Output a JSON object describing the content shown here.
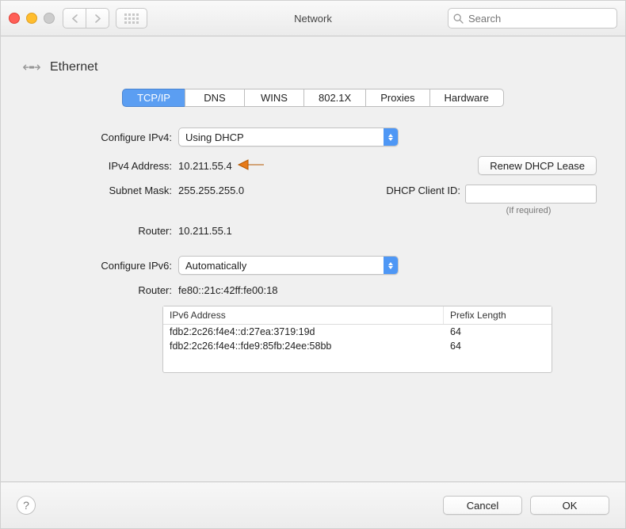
{
  "window": {
    "title": "Network"
  },
  "toolbar": {
    "search_placeholder": "Search"
  },
  "page": {
    "title": "Ethernet"
  },
  "tabs": [
    "TCP/IP",
    "DNS",
    "WINS",
    "802.1X",
    "Proxies",
    "Hardware"
  ],
  "ipv4": {
    "configure_label": "Configure IPv4:",
    "configure_value": "Using DHCP",
    "address_label": "IPv4 Address:",
    "address_value": "10.211.55.4",
    "subnet_label": "Subnet Mask:",
    "subnet_value": "255.255.255.0",
    "router_label": "Router:",
    "router_value": "10.211.55.1",
    "renew_button": "Renew DHCP Lease",
    "dhcp_client_label": "DHCP Client ID:",
    "dhcp_client_value": "",
    "dhcp_client_note": "(If required)"
  },
  "ipv6": {
    "configure_label": "Configure IPv6:",
    "configure_value": "Automatically",
    "router_label": "Router:",
    "router_value": "fe80::21c:42ff:fe00:18",
    "table": {
      "cols": [
        "IPv6 Address",
        "Prefix Length"
      ],
      "rows": [
        {
          "addr": "fdb2:2c26:f4e4::d:27ea:3719:19d",
          "prefix": "64"
        },
        {
          "addr": "fdb2:2c26:f4e4::fde9:85fb:24ee:58bb",
          "prefix": "64"
        }
      ]
    }
  },
  "footer": {
    "cancel": "Cancel",
    "ok": "OK",
    "help": "?"
  }
}
